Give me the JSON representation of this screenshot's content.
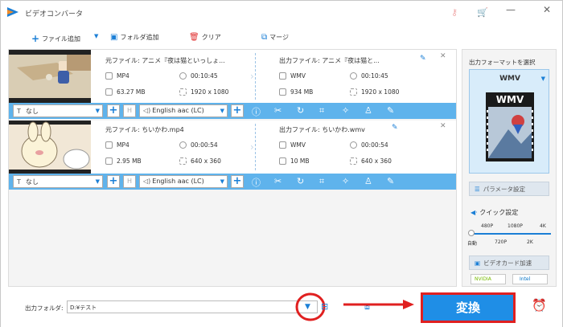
{
  "app": {
    "title": "ビデオコンバータ"
  },
  "toolbar": {
    "add_file": "ファイル追加",
    "add_folder": "フォルダ追加",
    "clear": "クリア",
    "merge": "マージ"
  },
  "files": [
    {
      "source_name": "元ファイル: アニメ『夜は猫といっしょ...",
      "source_format": "MP4",
      "source_duration": "00:10:45",
      "source_size": "63.27 MB",
      "source_resolution": "1920 x 1080",
      "output_name": "出力ファイル: アニメ『夜は猫と...",
      "output_format": "WMV",
      "output_duration": "00:10:45",
      "output_size": "934 MB",
      "output_resolution": "1920 x 1080",
      "subtitle": "なし",
      "audio": "English aac (LC)"
    },
    {
      "source_name": "元ファイル: ちいかわ.mp4",
      "source_format": "MP4",
      "source_duration": "00:00:54",
      "source_size": "2.95 MB",
      "source_resolution": "640 x 360",
      "output_name": "出力ファイル: ちいかわ.wmv",
      "output_format": "WMV",
      "output_duration": "00:00:54",
      "output_size": "10 MB",
      "output_resolution": "640 x 360",
      "subtitle": "なし",
      "audio": "English aac (LC)"
    }
  ],
  "right_panel": {
    "format_label": "出力フォーマットを選択",
    "format_name": "WMV",
    "format_badge": "WMV",
    "param_button": "パラメータ設定",
    "quick_label": "クイック設定",
    "quality_top": [
      "480P",
      "1080P",
      "4K"
    ],
    "quality_bottom": [
      "自動",
      "720P",
      "2K"
    ],
    "gpu_button": "ビデオカード加速",
    "gpu_nvidia": "NVIDIA",
    "gpu_intel": "Intel"
  },
  "bottom": {
    "output_label": "出力フォルダ:",
    "output_path": "D:¥テスト",
    "convert_label": "変換"
  },
  "colors": {
    "accent": "#1f8ee6",
    "bar": "#5fb3ec",
    "highlight": "#e02020"
  }
}
